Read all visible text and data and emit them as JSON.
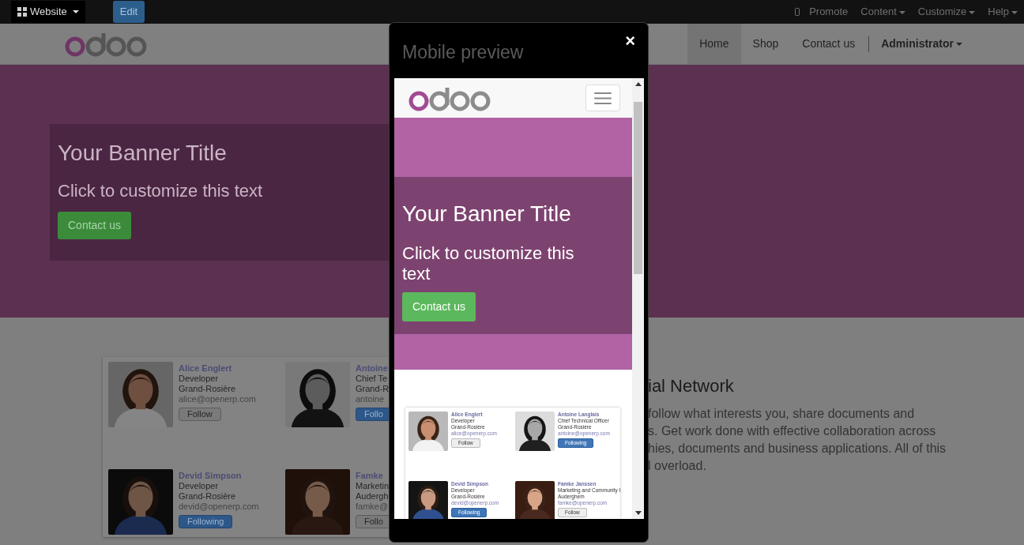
{
  "top_bar": {
    "website_menu": "Website",
    "edit_button": "Edit",
    "right_items": [
      {
        "label": "Promote",
        "dropdown": false
      },
      {
        "label": "Content",
        "dropdown": true
      },
      {
        "label": "Customize",
        "dropdown": true
      },
      {
        "label": "Help",
        "dropdown": true
      }
    ]
  },
  "site_nav": {
    "items": [
      {
        "label": "Home",
        "selected": true
      },
      {
        "label": "Shop",
        "selected": false
      },
      {
        "label": "Contact us",
        "selected": false
      }
    ],
    "user": "Administrator"
  },
  "banner": {
    "title": "Your Banner Title",
    "text": "Click to customize this text",
    "button": "Contact us"
  },
  "people": [
    {
      "name": "Alice Englert",
      "title": "Developer",
      "location": "Grand-Rosière",
      "email": "alice@openerp.com",
      "button": "Follow",
      "following": false
    },
    {
      "name": "Antoine",
      "title": "Chief Te",
      "location": "Grand-R",
      "email": "antoine",
      "button": "Follo",
      "following": true
    },
    {
      "name": "Devid Simpson",
      "title": "Developer",
      "location": "Grand-Rosière",
      "email": "devid@openerp.com",
      "button": "Following",
      "following": true
    },
    {
      "name": "Famke",
      "title": "Marketin",
      "location": "Audergh",
      "email": "famke@",
      "button": "Follo",
      "following": false
    }
  ],
  "section": {
    "heading": "ial Network",
    "lines": [
      "follow what interests you, share documents and",
      "s. Get work done with effective collaboration across",
      "hies, documents and business applications. All of this",
      "l overload."
    ]
  },
  "mobile_preview": {
    "title": "Mobile preview",
    "close": "×",
    "banner": {
      "title": "Your Banner Title",
      "text": "Click to customize this text",
      "button": "Contact us"
    },
    "people": [
      {
        "name": "Alice Englert",
        "title": "Developer",
        "location": "Grand-Rosière",
        "email": "alice@openerp.com",
        "button": "Follow",
        "following": false
      },
      {
        "name": "Antoine Langlais",
        "title": "Chief Technical Officer",
        "location": "Grand-Rosière",
        "email": "antoine@openerp.com",
        "button": "Following",
        "following": true
      },
      {
        "name": "Devid Simpson",
        "title": "Developer",
        "location": "Grand-Rosière",
        "email": "devid@openerp.com",
        "button": "Following",
        "following": true
      },
      {
        "name": "Famke Janssen",
        "title": "Marketing and Community I",
        "location": "Auderghem",
        "email": "famke@openerp.com",
        "button": "Follow",
        "following": false
      }
    ]
  }
}
